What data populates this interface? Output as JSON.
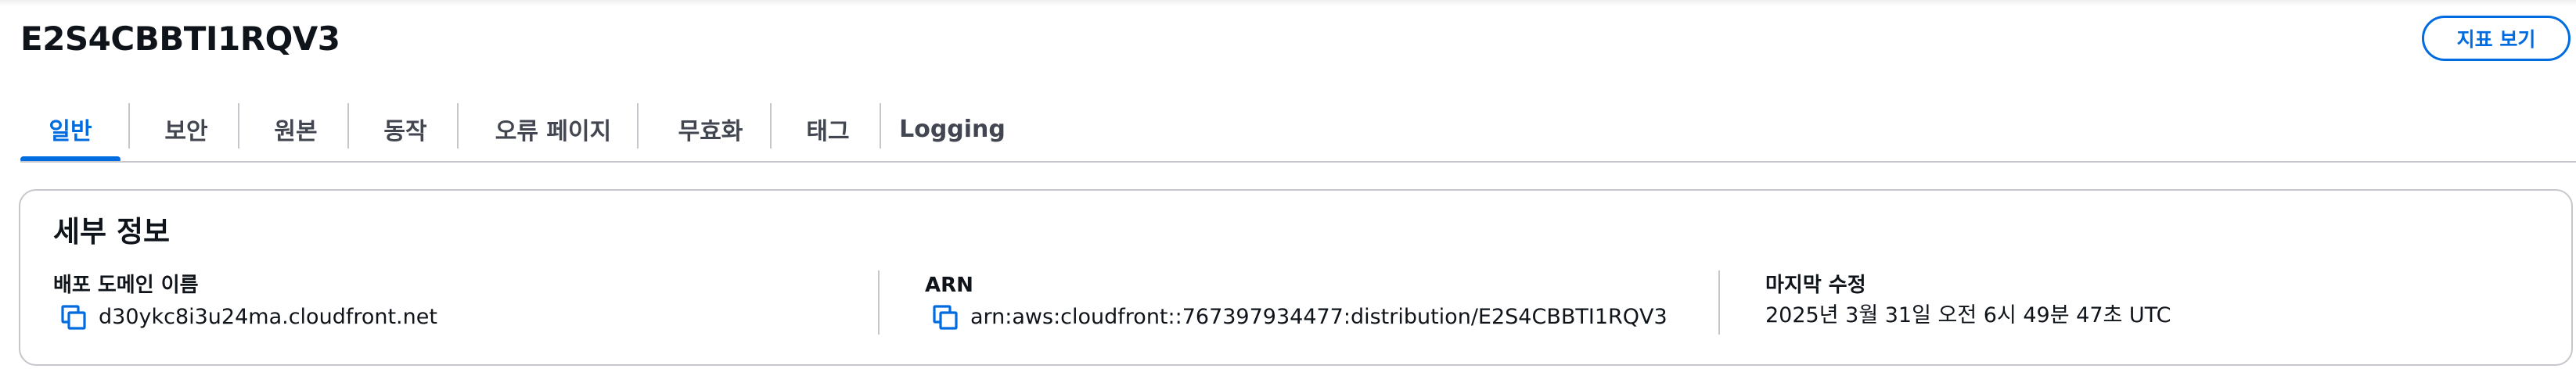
{
  "page": {
    "title": "E2S4CBBTI1RQV3",
    "view_metrics_label": "지표 보기"
  },
  "tabs": [
    {
      "label": "일반",
      "active": true
    },
    {
      "label": "보안",
      "active": false
    },
    {
      "label": "원본",
      "active": false
    },
    {
      "label": "동작",
      "active": false
    },
    {
      "label": "오류 페이지",
      "active": false
    },
    {
      "label": "무효화",
      "active": false
    },
    {
      "label": "태그",
      "active": false
    },
    {
      "label": "Logging",
      "active": false
    }
  ],
  "details": {
    "title": "세부 정보",
    "fields": [
      {
        "label": "배포 도메인 이름",
        "value": "d30ykc8i3u24ma.cloudfront.net",
        "copy_icon": "copy-icon"
      },
      {
        "label": "ARN",
        "value": "arn:aws:cloudfront::767397934477:distribution/E2S4CBBTI1RQV3",
        "copy_icon": "copy-icon"
      },
      {
        "label": "마지막 수정",
        "value": "2025년 3월 31일 오전 6시 49분 47초 UTC"
      }
    ]
  },
  "colors": {
    "accent": "#006ce0",
    "text": "#0f141a",
    "tab_text": "#424650",
    "border": "#c6c6cd"
  }
}
